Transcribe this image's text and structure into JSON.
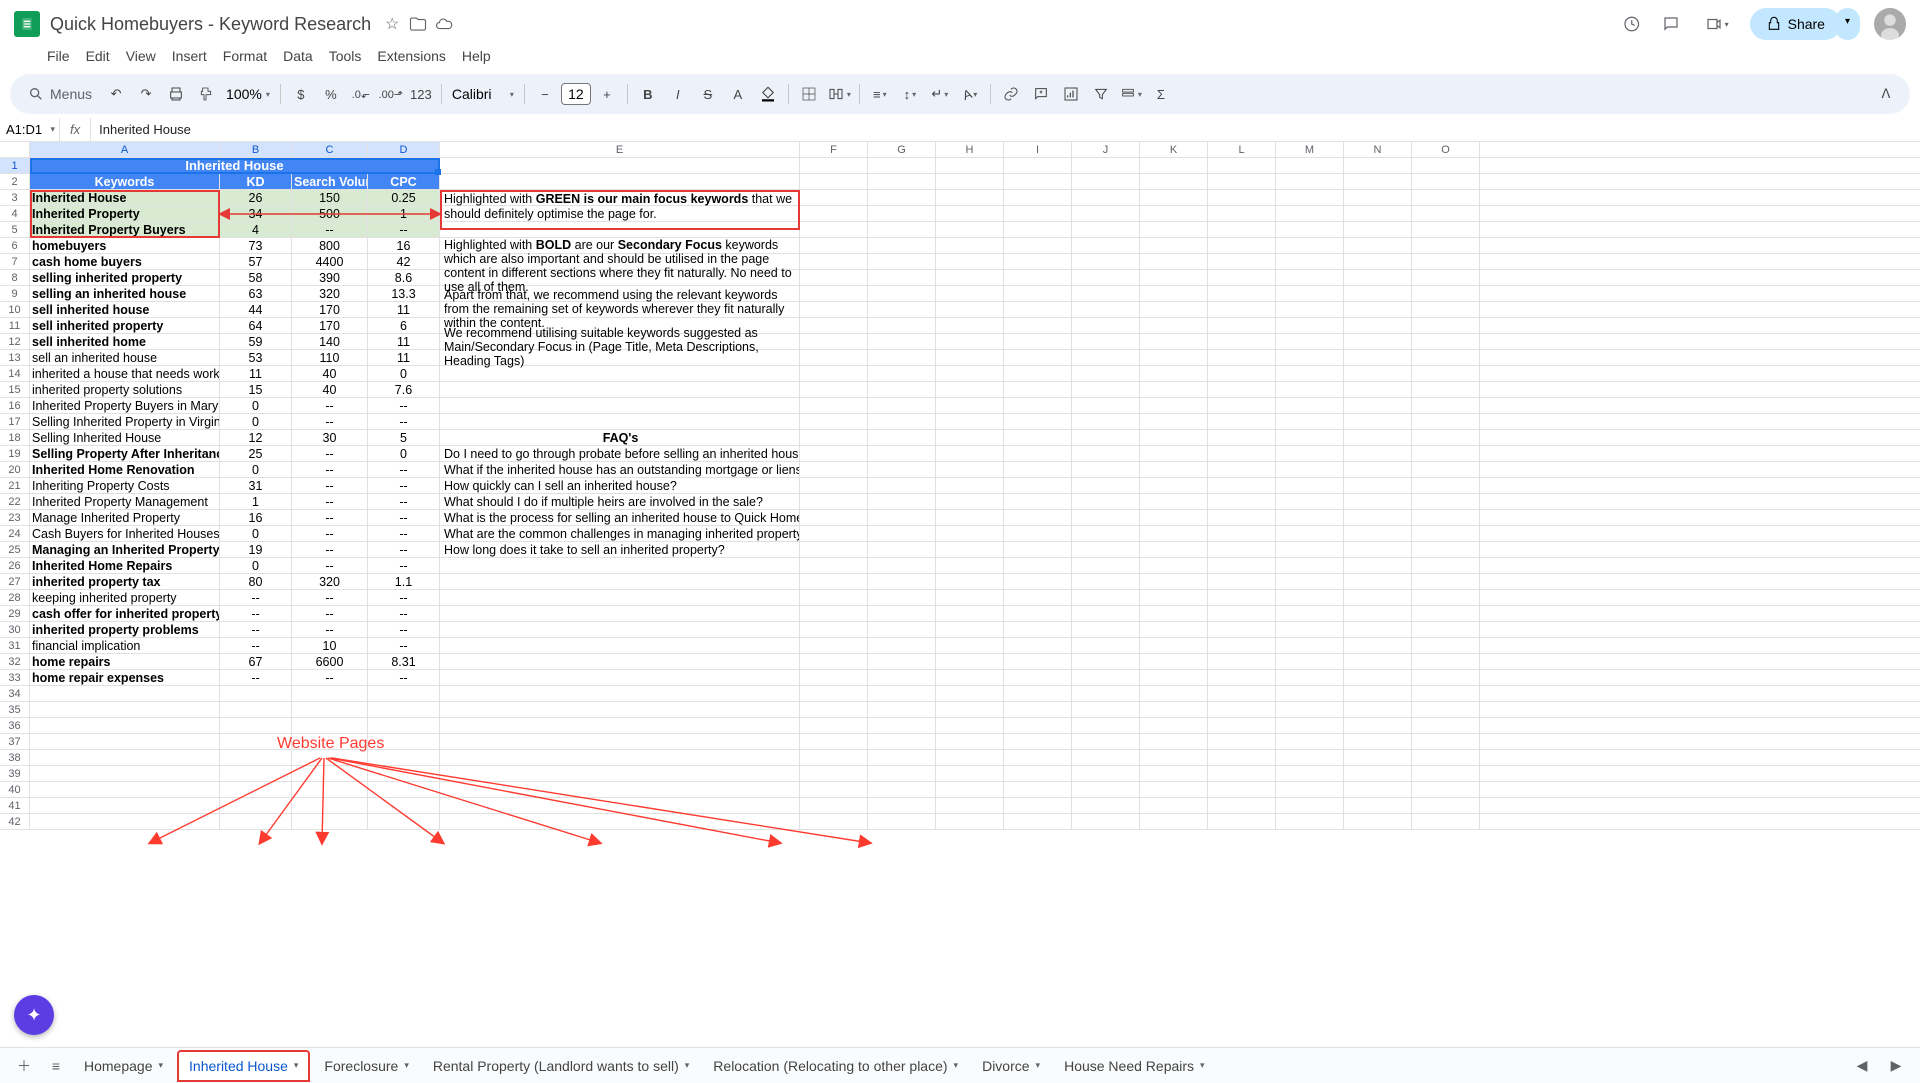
{
  "doc": {
    "title": "Quick Homebuyers  - Keyword Research"
  },
  "menus": [
    "File",
    "Edit",
    "View",
    "Insert",
    "Format",
    "Data",
    "Tools",
    "Extensions",
    "Help"
  ],
  "toolbar": {
    "search_placeholder": "Menus",
    "zoom": "100%",
    "font": "Calibri",
    "font_size": "12"
  },
  "share": "Share",
  "namebox": "A1:D1",
  "formula": "Inherited House",
  "cols": [
    "A",
    "B",
    "C",
    "D",
    "E",
    "F",
    "G",
    "H",
    "I",
    "J",
    "K",
    "L",
    "M",
    "N",
    "O"
  ],
  "title_row": "Inherited House",
  "headers": {
    "a": "Keywords",
    "b": "KD",
    "c": "Search Volume",
    "d": "CPC"
  },
  "rows": [
    {
      "n": 3,
      "a": "Inherited House",
      "b": "26",
      "c": "150",
      "d": "0.25",
      "green": true,
      "e": ""
    },
    {
      "n": 4,
      "a": "Inherited Property",
      "b": "34",
      "c": "500",
      "d": "1",
      "green": true,
      "e": ""
    },
    {
      "n": 5,
      "a": "Inherited Property Buyers",
      "b": "4",
      "c": "--",
      "d": "--",
      "green": true,
      "e": ""
    },
    {
      "n": 6,
      "a": "homebuyers",
      "b": "73",
      "c": "800",
      "d": "16",
      "bold": true,
      "e": ""
    },
    {
      "n": 7,
      "a": "cash home buyers",
      "b": "57",
      "c": "4400",
      "d": "42",
      "bold": true,
      "e": ""
    },
    {
      "n": 8,
      "a": "selling inherited property",
      "b": "58",
      "c": "390",
      "d": "8.6",
      "bold": true,
      "e": ""
    },
    {
      "n": 9,
      "a": "selling an inherited house",
      "b": "63",
      "c": "320",
      "d": "13.3",
      "bold": true,
      "e": ""
    },
    {
      "n": 10,
      "a": "sell inherited house",
      "b": "44",
      "c": "170",
      "d": "11",
      "bold": true,
      "e": ""
    },
    {
      "n": 11,
      "a": "sell inherited property",
      "b": "64",
      "c": "170",
      "d": "6",
      "bold": true,
      "e": ""
    },
    {
      "n": 12,
      "a": "sell inherited home",
      "b": "59",
      "c": "140",
      "d": "11",
      "bold": true,
      "e": ""
    },
    {
      "n": 13,
      "a": "sell an inherited house",
      "b": "53",
      "c": "110",
      "d": "11",
      "e": ""
    },
    {
      "n": 14,
      "a": "inherited a house that needs work",
      "b": "11",
      "c": "40",
      "d": "0",
      "e": ""
    },
    {
      "n": 15,
      "a": "inherited property solutions",
      "b": "15",
      "c": "40",
      "d": "7.6",
      "e": ""
    },
    {
      "n": 16,
      "a": "Inherited Property Buyers in Maryland",
      "b": "0",
      "c": "--",
      "d": "--",
      "e": ""
    },
    {
      "n": 17,
      "a": "Selling Inherited Property in Virginia",
      "b": "0",
      "c": "--",
      "d": "--",
      "e": ""
    },
    {
      "n": 18,
      "a": "Selling Inherited House",
      "b": "12",
      "c": "30",
      "d": "5",
      "e": "FAQ's",
      "ecenter": true,
      "ebold": true
    },
    {
      "n": 19,
      "a": "Selling Property After Inheritance",
      "b": "25",
      "c": "--",
      "d": "0",
      "bold": true,
      "e": "Do I need to go through probate before selling an inherited house?"
    },
    {
      "n": 20,
      "a": "Inherited Home Renovation",
      "b": "0",
      "c": "--",
      "d": "--",
      "bold": true,
      "e": "What if the inherited house has an outstanding mortgage or liens?"
    },
    {
      "n": 21,
      "a": "Inheriting Property Costs",
      "b": "31",
      "c": "--",
      "d": "--",
      "e": "How quickly can I sell an inherited house?"
    },
    {
      "n": 22,
      "a": "Inherited Property Management",
      "b": "1",
      "c": "--",
      "d": "--",
      "e": "What should I do if multiple heirs are involved in the sale?"
    },
    {
      "n": 23,
      "a": "Manage Inherited Property",
      "b": "16",
      "c": "--",
      "d": "--",
      "e": "What is the process for selling an inherited house to Quick Homebuyers?"
    },
    {
      "n": 24,
      "a": "Cash Buyers for Inherited Houses",
      "b": "0",
      "c": "--",
      "d": "--",
      "e": "What are the common challenges in managing inherited property?"
    },
    {
      "n": 25,
      "a": "Managing an Inherited Property",
      "b": "19",
      "c": "--",
      "d": "--",
      "bold": true,
      "e": "How long does it take to sell an inherited property?"
    },
    {
      "n": 26,
      "a": "Inherited Home Repairs",
      "b": "0",
      "c": "--",
      "d": "--",
      "bold": true,
      "e": ""
    },
    {
      "n": 27,
      "a": "inherited property tax",
      "b": "80",
      "c": "320",
      "d": "1.1",
      "bold": true,
      "e": ""
    },
    {
      "n": 28,
      "a": "keeping inherited property",
      "b": "--",
      "c": "--",
      "d": "--",
      "e": ""
    },
    {
      "n": 29,
      "a": "cash offer for inherited property",
      "b": "--",
      "c": "--",
      "d": "--",
      "bold": true,
      "e": ""
    },
    {
      "n": 30,
      "a": "inherited property problems",
      "b": "--",
      "c": "--",
      "d": "--",
      "bold": true,
      "e": ""
    },
    {
      "n": 31,
      "a": "financial implication",
      "b": "--",
      "c": "10",
      "d": "--",
      "e": ""
    },
    {
      "n": 32,
      "a": "home repairs",
      "b": "67",
      "c": "6600",
      "d": "8.31",
      "bold": true,
      "e": ""
    },
    {
      "n": 33,
      "a": "home repair expenses",
      "b": "--",
      "c": "--",
      "d": "--",
      "bold": true,
      "e": ""
    },
    {
      "n": 34,
      "a": "",
      "b": "",
      "c": "",
      "d": "",
      "e": ""
    },
    {
      "n": 35,
      "a": "",
      "b": "",
      "c": "",
      "d": "",
      "e": ""
    },
    {
      "n": 36,
      "a": "",
      "b": "",
      "c": "",
      "d": "",
      "e": ""
    },
    {
      "n": 37,
      "a": "",
      "b": "",
      "c": "",
      "d": "",
      "e": ""
    },
    {
      "n": 38,
      "a": "",
      "b": "",
      "c": "",
      "d": "",
      "e": ""
    },
    {
      "n": 39,
      "a": "",
      "b": "",
      "c": "",
      "d": "",
      "e": ""
    },
    {
      "n": 40,
      "a": "",
      "b": "",
      "c": "",
      "d": "",
      "e": ""
    },
    {
      "n": 41,
      "a": "",
      "b": "",
      "c": "",
      "d": "",
      "e": ""
    },
    {
      "n": 42,
      "a": "",
      "b": "",
      "c": "",
      "d": "",
      "e": ""
    }
  ],
  "notes": {
    "line1a": "Highlighted with ",
    "line1b": "GREEN is our main focus keywords",
    "line1c": " that we should definitely optimise the page for.",
    "line2a": "Highlighted with ",
    "line2b": "BOLD",
    "line2c": " are our ",
    "line2d": "Secondary Focus",
    "line2e": " keywords which are also important and should be utilised in the page content in different sections where they fit naturally. No need to use all of them.",
    "line3": "Apart from that, we recommend using the relevant keywords from the remaining set of keywords wherever they fit naturally within the content.",
    "line4": "We recommend utilising suitable keywords suggested as Main/Secondary Focus in (Page Title, Meta Descriptions, Heading Tags)"
  },
  "annotation_label": "Website Pages",
  "tabs": [
    "Homepage",
    "Inherited House",
    "Foreclosure",
    "Rental Property (Landlord wants to sell)",
    "Relocation (Relocating to other place)",
    "Divorce",
    "House Need Repairs"
  ],
  "active_tab": 1
}
